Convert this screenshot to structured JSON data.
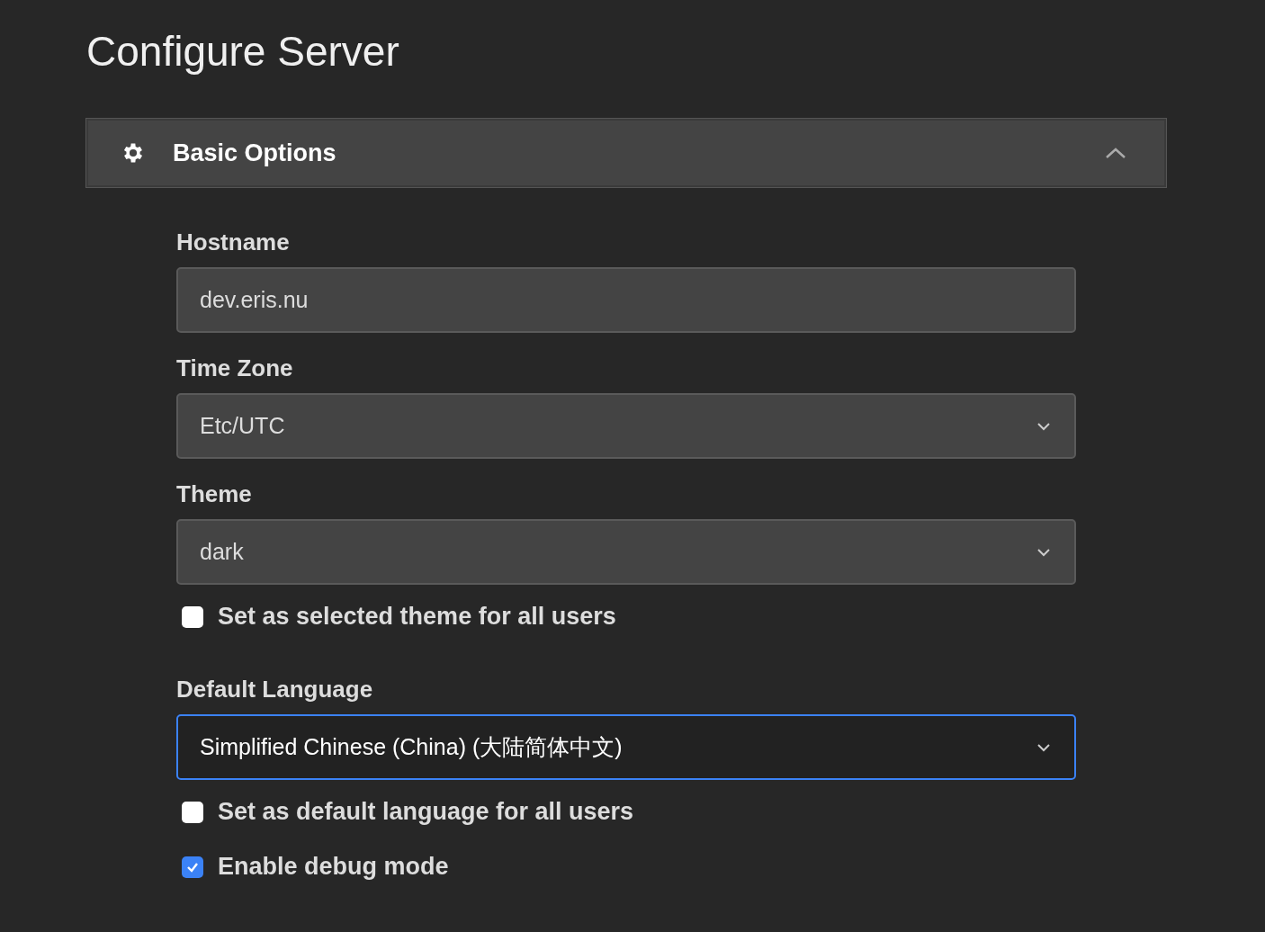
{
  "page_title": "Configure Server",
  "panel": {
    "title": "Basic Options",
    "expanded": true
  },
  "fields": [
    {
      "kind": "text",
      "label": "Hostname",
      "value": "dev.eris.nu",
      "focused": false
    },
    {
      "kind": "select",
      "label": "Time Zone",
      "value": "Etc/UTC",
      "focused": false
    },
    {
      "kind": "select",
      "label": "Theme",
      "value": "dark",
      "focused": false
    },
    {
      "kind": "checkbox",
      "label": "Set as selected theme for all users",
      "checked": false
    },
    {
      "kind": "select",
      "label": "Default Language",
      "value": "Simplified Chinese (China) (大陆简体中文)",
      "focused": true
    },
    {
      "kind": "checkbox",
      "label": "Set as default language for all users",
      "checked": false
    },
    {
      "kind": "checkbox",
      "label": "Enable debug mode",
      "checked": true
    }
  ]
}
